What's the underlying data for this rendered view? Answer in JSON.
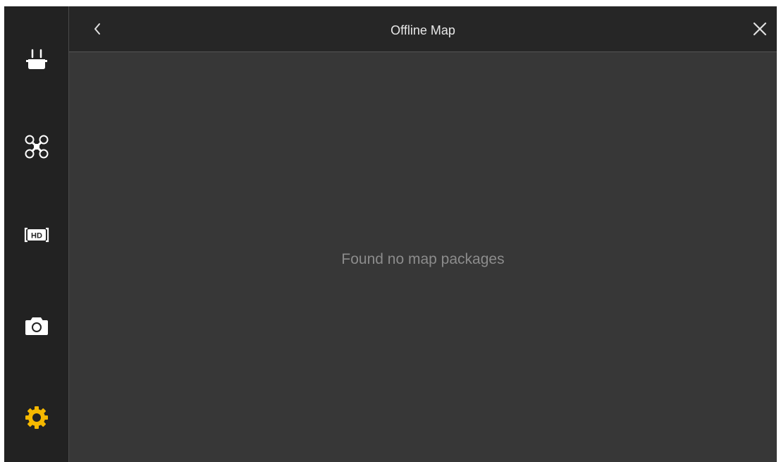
{
  "header": {
    "title": "Offline Map"
  },
  "content": {
    "empty_message": "Found no map packages"
  },
  "sidebar": {
    "items": [
      {
        "icon": "remote-controller-icon",
        "active": false
      },
      {
        "icon": "aircraft-icon",
        "active": false
      },
      {
        "icon": "hd-transmission-icon",
        "active": false
      },
      {
        "icon": "camera-icon",
        "active": false
      },
      {
        "icon": "settings-gear-icon",
        "active": true
      }
    ]
  },
  "colors": {
    "accent": "#f5b800",
    "icon": "#ffffff",
    "sidebar_bg": "#222222",
    "header_bg": "#262626",
    "content_bg": "#373737",
    "muted_text": "#8c8c8c"
  }
}
